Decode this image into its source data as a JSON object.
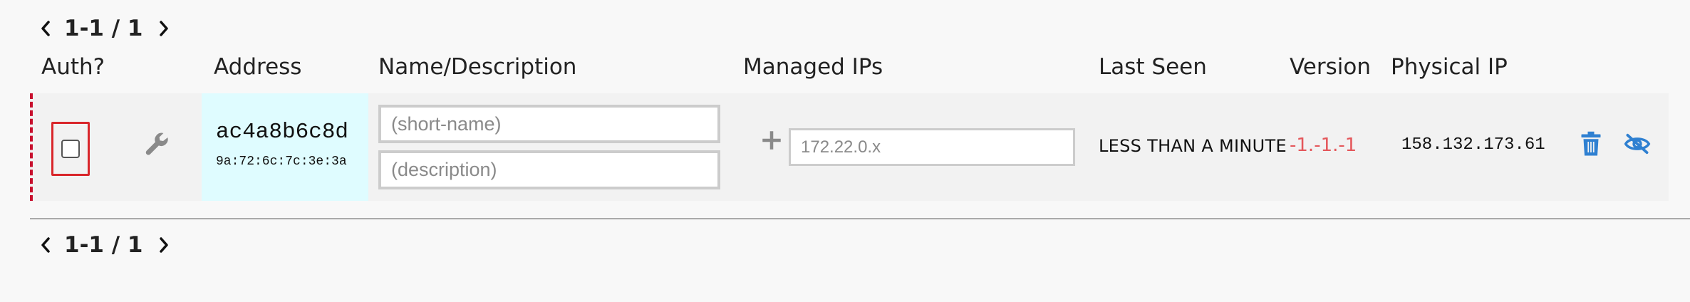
{
  "pager": {
    "top_text": "1-1 / 1",
    "bottom_text": "1-1 / 1"
  },
  "headers": {
    "auth": "Auth?",
    "address": "Address",
    "name": "Name/Description",
    "managed_ips": "Managed IPs",
    "last_seen": "Last Seen",
    "version": "Version",
    "physical_ip": "Physical IP"
  },
  "member": {
    "authorized": false,
    "address": "ac4a8b6c8d",
    "mac": "9a:72:6c:7c:3e:3a",
    "short_name_placeholder": "(short-name)",
    "description_placeholder": "(description)",
    "ip_placeholder": "172.22.0.x",
    "last_seen": "LESS THAN A MINUTE",
    "version": "-1.-1.-1",
    "physical_ip": "158.132.173.61"
  },
  "icons": {
    "prev": "chevron-left-icon",
    "next": "chevron-right-icon",
    "settings": "wrench-icon",
    "add": "plus-icon",
    "delete": "trash-icon",
    "hide": "eye-slash-icon"
  },
  "colors": {
    "address_highlight": "#dffcff",
    "version_text": "#e4575b",
    "action_icon": "#2f80d1",
    "checkbox_border": "#d9262b",
    "row_marker": "#c8102e"
  }
}
